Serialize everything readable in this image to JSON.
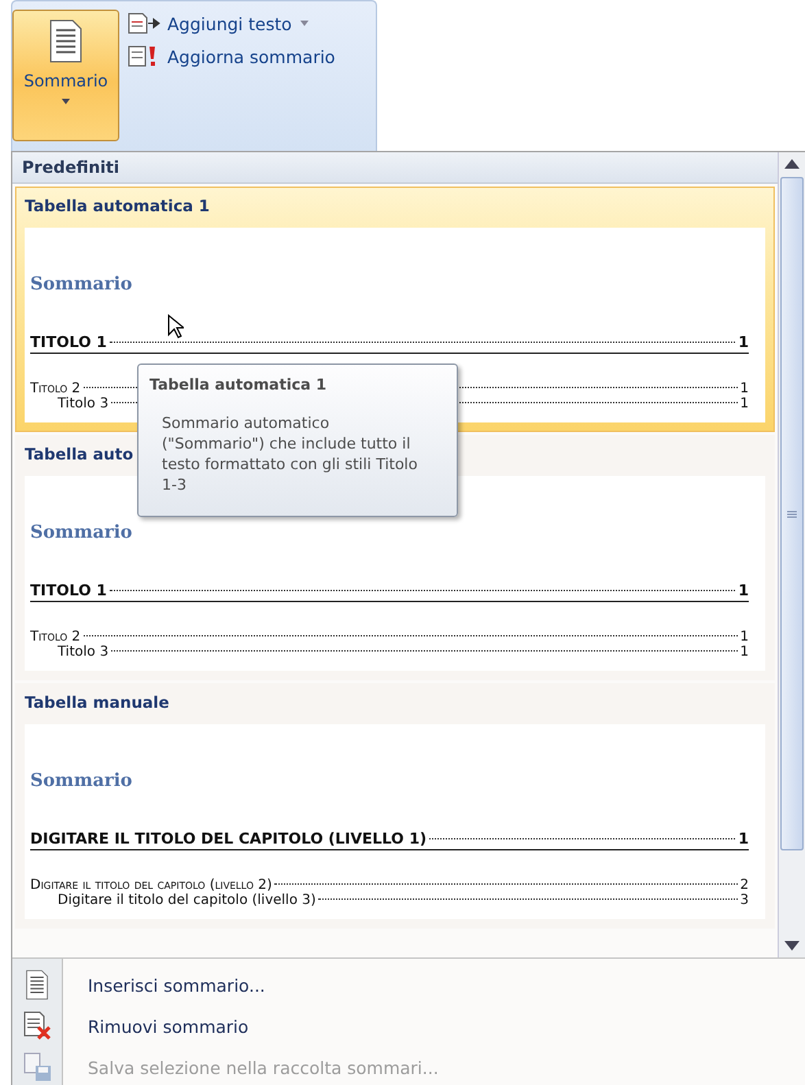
{
  "ribbon": {
    "large_button": {
      "label": "Sommario",
      "selected": true
    },
    "small_buttons": [
      {
        "kind": "add",
        "label": "Aggiungi testo",
        "dropdown": true
      },
      {
        "kind": "update",
        "label": "Aggiorna sommario",
        "dropdown": false
      }
    ]
  },
  "gallery": {
    "header": "Predefiniti",
    "items": [
      {
        "title": "Tabella automatica 1",
        "selected": true,
        "preview": {
          "heading": "Sommario",
          "entries": [
            {
              "kind": "h1",
              "text": "TITOLO 1",
              "page": "1"
            },
            {
              "kind": "h2",
              "text": "Titolo 2",
              "page": "1"
            },
            {
              "kind": "h3",
              "text": "Titolo 3",
              "page": "1"
            }
          ]
        }
      },
      {
        "title": "Tabella auto",
        "selected": false,
        "preview": {
          "heading": "Sommario",
          "entries": [
            {
              "kind": "h1",
              "text": "TITOLO 1",
              "page": "1"
            },
            {
              "kind": "h2",
              "text": "Titolo 2",
              "page": "1"
            },
            {
              "kind": "h3",
              "text": "Titolo 3",
              "page": "1"
            }
          ]
        }
      },
      {
        "title": "Tabella manuale",
        "selected": false,
        "preview": {
          "heading": "Sommario",
          "entries": [
            {
              "kind": "h1",
              "text": "DIGITARE IL TITOLO DEL CAPITOLO (LIVELLO 1)",
              "page": "1"
            },
            {
              "kind": "h2",
              "text": "Digitare il titolo del capitolo (livello 2)",
              "page": "2"
            },
            {
              "kind": "h3",
              "text": "Digitare il titolo del capitolo (livello 3)",
              "page": "3"
            }
          ]
        }
      }
    ]
  },
  "tooltip": {
    "title": "Tabella automatica 1",
    "description": "Sommario automatico (\"Sommario\") che include tutto il testo formattato con gli stili Titolo 1-3"
  },
  "menu": [
    {
      "kind": "insert",
      "label": "Inserisci sommario...",
      "disabled": false
    },
    {
      "kind": "remove",
      "label": "Rimuovi sommario",
      "disabled": false
    },
    {
      "kind": "save",
      "label": "Salva selezione nella raccolta sommari...",
      "disabled": true
    }
  ]
}
